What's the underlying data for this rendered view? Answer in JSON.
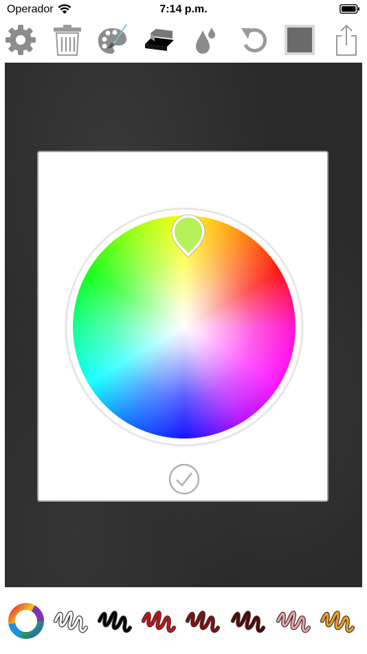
{
  "status_bar": {
    "carrier": "Operador",
    "time": "7:14 p.m."
  },
  "toolbar": {
    "items": [
      {
        "icon": "gear-icon"
      },
      {
        "icon": "trash-icon"
      },
      {
        "icon": "palette-brush-icon"
      },
      {
        "icon": "eraser-icon"
      },
      {
        "icon": "drops-icon"
      },
      {
        "icon": "undo-icon"
      },
      {
        "icon": "canvas-square-icon"
      },
      {
        "icon": "share-icon"
      }
    ]
  },
  "color_picker": {
    "selected_color": "#b6f05a",
    "confirm_icon": "checkmark-icon"
  },
  "palette": {
    "items": [
      {
        "icon": "color-wheel-icon"
      },
      {
        "icon": "scribble-icon",
        "color": "#ffffff"
      },
      {
        "icon": "scribble-icon",
        "color": "#000000"
      },
      {
        "icon": "scribble-icon",
        "color": "#cc1111"
      },
      {
        "icon": "scribble-icon",
        "color": "#8b0a0a"
      },
      {
        "icon": "scribble-icon",
        "color": "#5c0404"
      },
      {
        "icon": "scribble-icon",
        "color": "#f0a0a8"
      },
      {
        "icon": "scribble-icon",
        "color": "#f0a020"
      }
    ]
  }
}
